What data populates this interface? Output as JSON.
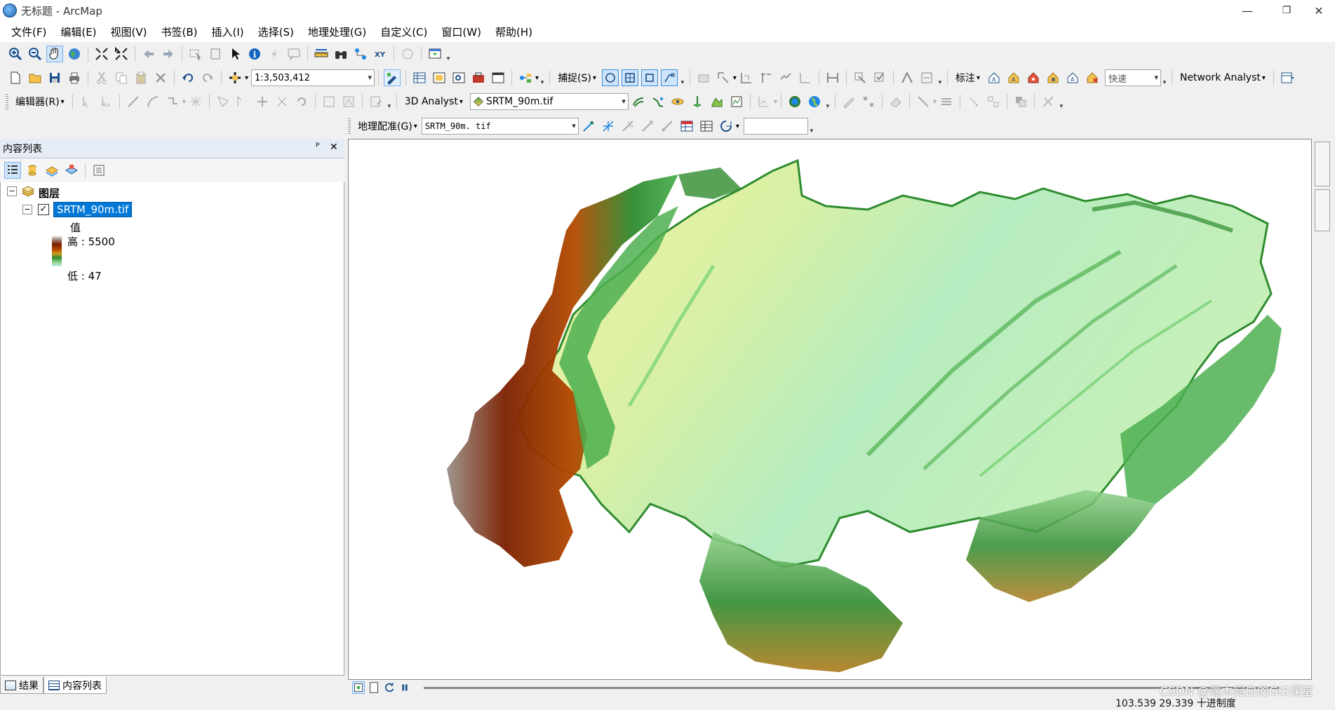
{
  "window": {
    "title": "无标题 - ArcMap",
    "min": "—",
    "restore": "❐",
    "close": "✕"
  },
  "menus": [
    "文件(F)",
    "编辑(E)",
    "视图(V)",
    "书签(B)",
    "插入(I)",
    "选择(S)",
    "地理处理(G)",
    "自定义(C)",
    "窗口(W)",
    "帮助(H)"
  ],
  "toolbar": {
    "scale": "1:3,503,412",
    "snapping": "捕捉(S)",
    "label": "标注",
    "quality": "快速",
    "network_analyst": "Network Analyst",
    "editor": "编辑器(R)",
    "analyst3d": "3D Analyst",
    "layer3d": "SRTM_90m.tif",
    "georef": "地理配准(G)",
    "georef_layer": "SRTM_90m. tif"
  },
  "toc": {
    "title": "内容列表",
    "pin": "ᴾ",
    "close": "✕",
    "group": "图层",
    "layer": "SRTM_90m.tif",
    "value_label": "值",
    "high_label": "高 : 5500",
    "low_label": "低 : 47",
    "tabs": [
      "结果",
      "内容列表"
    ]
  },
  "status": {
    "coords": "103.539  29.339 十进制度"
  },
  "watermark": "CSDN @端木宛白的GIS课堂",
  "colors": {
    "accent": "#0078d7",
    "ramp": [
      "#ffffff",
      "#7a1f00",
      "#b44a00",
      "#2e8b2e",
      "#8fd18a",
      "#bfefe5"
    ]
  }
}
